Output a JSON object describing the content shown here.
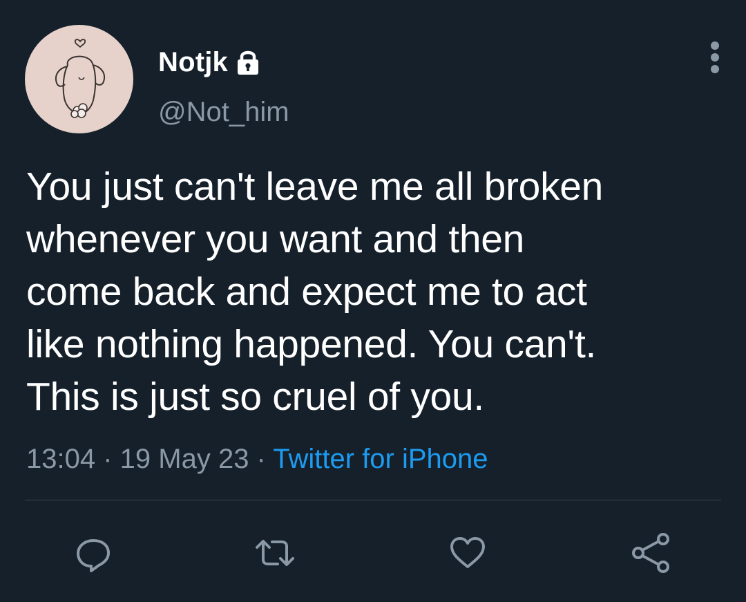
{
  "user": {
    "display_name": "Notjk",
    "handle": "@Not_him",
    "protected": true
  },
  "tweet": {
    "text": "You just can't leave me all broken\nwhenever you want and then\ncome back and expect me to act\nlike nothing happened. You can't.\nThis is just so cruel of you.",
    "time": "13:04",
    "separator": " · ",
    "date": "19 May 23",
    "source": "Twitter for iPhone"
  },
  "actions": [
    {
      "icon": "reply-icon"
    },
    {
      "icon": "retweet-icon"
    },
    {
      "icon": "like-icon"
    },
    {
      "icon": "share-icon"
    }
  ],
  "colors": {
    "background": "#15202b",
    "text": "#ffffff",
    "secondary_text": "#8b98a5",
    "link": "#1d9bf0",
    "divider": "#38444d",
    "avatar_bg": "#e6d2cb"
  }
}
